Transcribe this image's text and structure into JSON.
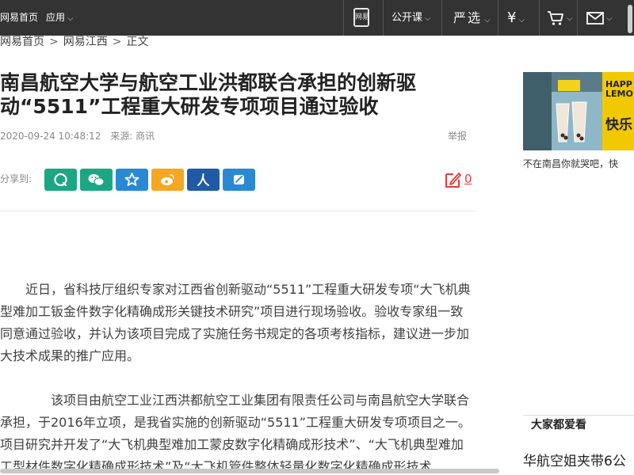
{
  "topbar": {
    "home": "网易首页",
    "apps": "应用",
    "mobile_icon_text": "网易",
    "open_course": "公开课",
    "yanxuan": "严选",
    "currency": "¥",
    "background_color": "#333333"
  },
  "breadcrumb": {
    "items": [
      "网易首页",
      "网易江西",
      "正文"
    ]
  },
  "article": {
    "title": "南昌航空大学与航空工业洪都联合承担的创新驱动“5511”工程重大研发专项项目通过验收",
    "date": "2020-09-24 10:48:12",
    "source": "来源: 商讯",
    "report": "举报",
    "share_label": "分享到:",
    "comment_count": "0",
    "paragraphs": [
      "近日，省科技厅组织专家对江西省创新驱动“5511”工程重大研发专项“大飞机典型难加工钣金件数字化精确成形关键技术研究”项目进行现场验收。验收专家组一致同意通过验收，并认为该项目完成了实施任务书规定的各项考核指标，建议进一步加大技术成果的推广应用。",
      "该项目由航空工业江西洪都航空工业集团有限责任公司与南昌航空大学联合承担，于2016年立项，是我省实施的创新驱动“5511”工程重大研发专项项目之一。项目研究并开发了“大飞机典型难加工蒙皮数字化精确成形技术”、“大飞机典型难加工型材件数字化精确成形技术”及“大飞机管件整体轻量化数字化精确成形技术"
    ]
  },
  "share_buttons": [
    {
      "name": "share-qq-icon",
      "color": "#1ba784"
    },
    {
      "name": "share-wechat-icon",
      "color": "#1ba784"
    },
    {
      "name": "share-qzone-icon",
      "color": "#2a89d4"
    },
    {
      "name": "share-weibo-icon",
      "color": "#f5a623"
    },
    {
      "name": "share-renren-icon",
      "color": "#1f5aa6"
    },
    {
      "name": "share-other-icon",
      "color": "#2a89d4"
    }
  ],
  "sidebar": {
    "ad_text_lines": [
      "HAPP",
      "LEMO",
      "快乐"
    ],
    "ad_caption": "不在南昌你就哭吧，快",
    "popular_title": "大家都爱看",
    "popular_item": "华航空姐夹带6公"
  },
  "colors": {
    "accent_red": "#e33b3b",
    "text": "#404040"
  }
}
